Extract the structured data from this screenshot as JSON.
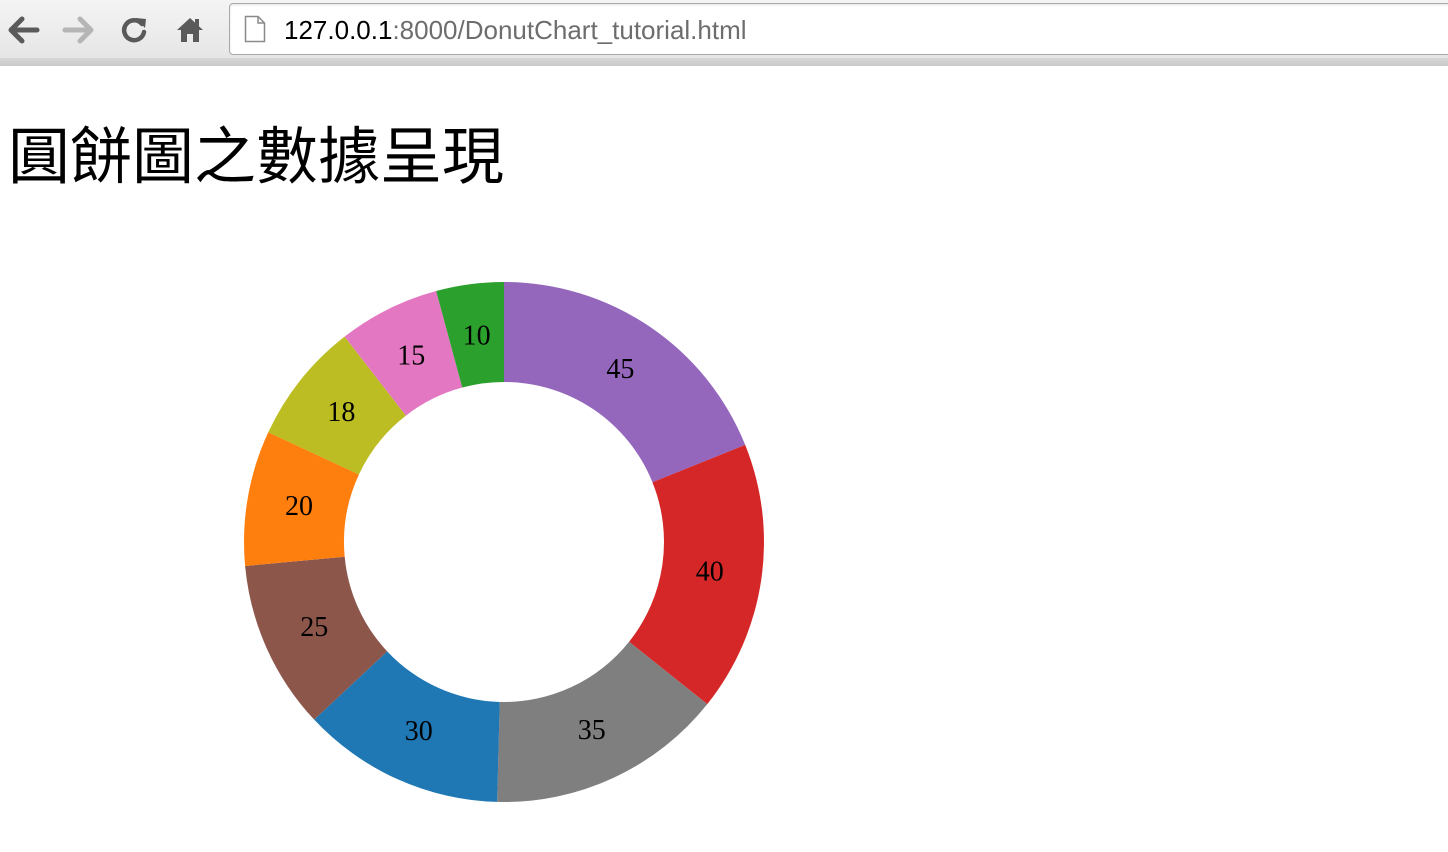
{
  "browser": {
    "url_host": "127.0.0.1",
    "url_rest": ":8000/DonutChart_tutorial.html"
  },
  "page": {
    "title": "圓餅圖之數據呈現"
  },
  "chart_data": {
    "type": "pie",
    "donut": true,
    "title": "",
    "start_angle_deg": 0,
    "direction": "clockwise",
    "slices": [
      {
        "value": 45,
        "label": "45",
        "color": "#9467bd"
      },
      {
        "value": 40,
        "label": "40",
        "color": "#d62728"
      },
      {
        "value": 35,
        "label": "35",
        "color": "#7f7f7f"
      },
      {
        "value": 30,
        "label": "30",
        "color": "#1f77b4"
      },
      {
        "value": 25,
        "label": "25",
        "color": "#8c564b"
      },
      {
        "value": 20,
        "label": "20",
        "color": "#ff7f0e"
      },
      {
        "value": 18,
        "label": "18",
        "color": "#bcbd22"
      },
      {
        "value": 15,
        "label": "15",
        "color": "#e377c2"
      },
      {
        "value": 10,
        "label": "10",
        "color": "#2ca02c"
      }
    ]
  }
}
